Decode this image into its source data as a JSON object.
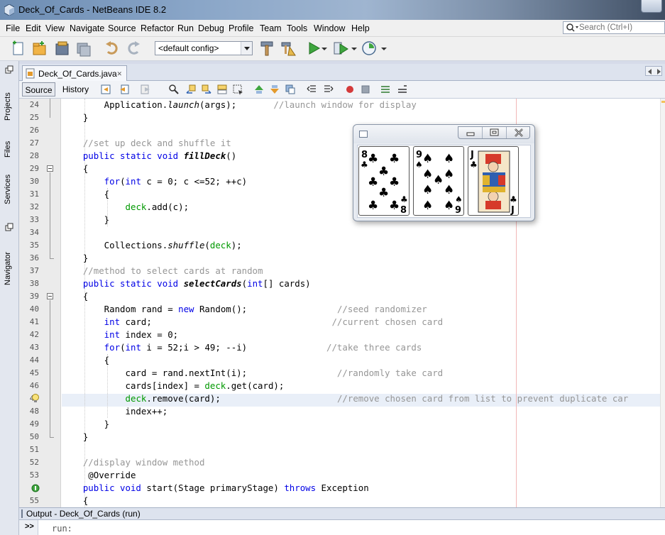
{
  "window": {
    "title": "Deck_Of_Cards - NetBeans IDE 8.2"
  },
  "menu": [
    "File",
    "Edit",
    "View",
    "Navigate",
    "Source",
    "Refactor",
    "Run",
    "Debug",
    "Profile",
    "Team",
    "Tools",
    "Window",
    "Help"
  ],
  "search": {
    "placeholder": "Search (Ctrl+I)"
  },
  "toolbar": {
    "config": "<default config>"
  },
  "sidebar": {
    "tabs": [
      "Projects",
      "Files",
      "Services",
      "Navigator"
    ]
  },
  "editor": {
    "tab": "Deck_Of_Cards.java",
    "source_label": "Source",
    "history_label": "History",
    "lines": [
      {
        "n": "24",
        "segs": [
          [
            "",
            "        Application."
          ],
          [
            "it",
            "launch"
          ],
          [
            "",
            "(args);       "
          ],
          [
            "cm",
            "//launch window for display"
          ]
        ]
      },
      {
        "n": "25",
        "segs": [
          [
            "",
            "    }"
          ]
        ]
      },
      {
        "n": "26",
        "segs": [
          [
            "",
            ""
          ]
        ]
      },
      {
        "n": "27",
        "segs": [
          [
            "cm",
            "    //set up deck and shuffle it"
          ]
        ]
      },
      {
        "n": "28",
        "segs": [
          [
            "kw",
            "    public static void "
          ],
          [
            "bi",
            "fillDeck"
          ],
          [
            "",
            "()"
          ]
        ]
      },
      {
        "n": "29",
        "segs": [
          [
            "",
            "    {"
          ]
        ]
      },
      {
        "n": "30",
        "segs": [
          [
            "kw",
            "        for"
          ],
          [
            "",
            "("
          ],
          [
            "kw",
            "int"
          ],
          [
            "",
            " c = 0; c <=52; ++c)"
          ]
        ]
      },
      {
        "n": "31",
        "segs": [
          [
            "",
            "        {"
          ]
        ]
      },
      {
        "n": "32",
        "segs": [
          [
            "",
            "            "
          ],
          [
            "fld",
            "deck"
          ],
          [
            "",
            ".add(c);"
          ]
        ]
      },
      {
        "n": "33",
        "segs": [
          [
            "",
            "        }"
          ]
        ]
      },
      {
        "n": "34",
        "segs": [
          [
            "",
            ""
          ]
        ]
      },
      {
        "n": "35",
        "segs": [
          [
            "",
            "        Collections."
          ],
          [
            "it",
            "shuffle"
          ],
          [
            "",
            "("
          ],
          [
            "fld",
            "deck"
          ],
          [
            "",
            ");"
          ]
        ]
      },
      {
        "n": "36",
        "segs": [
          [
            "",
            "    }"
          ]
        ]
      },
      {
        "n": "37",
        "segs": [
          [
            "cm",
            "    //method to select cards at random"
          ]
        ]
      },
      {
        "n": "38",
        "segs": [
          [
            "kw",
            "    public static void "
          ],
          [
            "bi",
            "selectCards"
          ],
          [
            "",
            "("
          ],
          [
            "kw",
            "int"
          ],
          [
            "",
            "[] cards)"
          ]
        ]
      },
      {
        "n": "39",
        "segs": [
          [
            "",
            "    {"
          ]
        ]
      },
      {
        "n": "40",
        "segs": [
          [
            "",
            "        Random rand = "
          ],
          [
            "kw",
            "new"
          ],
          [
            "",
            " Random();                 "
          ],
          [
            "cm",
            "//seed randomizer"
          ]
        ]
      },
      {
        "n": "41",
        "segs": [
          [
            "kw",
            "        int"
          ],
          [
            "",
            " card;                                  "
          ],
          [
            "cm",
            "//current chosen card"
          ]
        ]
      },
      {
        "n": "42",
        "segs": [
          [
            "kw",
            "        int"
          ],
          [
            "",
            " index = 0;"
          ]
        ]
      },
      {
        "n": "43",
        "segs": [
          [
            "kw",
            "        for"
          ],
          [
            "",
            "("
          ],
          [
            "kw",
            "int"
          ],
          [
            "",
            " i = 52;i > 49; --i)               "
          ],
          [
            "cm",
            "//take three cards"
          ]
        ]
      },
      {
        "n": "44",
        "segs": [
          [
            "",
            "        {"
          ]
        ]
      },
      {
        "n": "45",
        "segs": [
          [
            "",
            "            card = rand.nextInt(i);                 "
          ],
          [
            "cm",
            "//randomly take card"
          ]
        ]
      },
      {
        "n": "46",
        "segs": [
          [
            "",
            "            cards[index] = "
          ],
          [
            "fld",
            "deck"
          ],
          [
            "",
            ".get(card);"
          ]
        ]
      },
      {
        "n": "47",
        "segs": [
          [
            "",
            "            "
          ],
          [
            "fld",
            "deck"
          ],
          [
            "",
            ".remove(card);                      "
          ],
          [
            "cm",
            "//remove chosen card from list to prevent duplicate car"
          ]
        ]
      },
      {
        "n": "48",
        "segs": [
          [
            "",
            "            index++;"
          ]
        ]
      },
      {
        "n": "49",
        "segs": [
          [
            "",
            "        }"
          ]
        ]
      },
      {
        "n": "50",
        "segs": [
          [
            "",
            "    }"
          ]
        ]
      },
      {
        "n": "51",
        "segs": [
          [
            "",
            ""
          ]
        ]
      },
      {
        "n": "52",
        "segs": [
          [
            "cm",
            "    //display window method"
          ]
        ]
      },
      {
        "n": "53",
        "segs": [
          [
            "",
            "     @Override"
          ]
        ]
      },
      {
        "n": "",
        "segs": [
          [
            "kw",
            "    public void "
          ],
          [
            "",
            "start(Stage primaryStage) "
          ],
          [
            "kw",
            "throws"
          ],
          [
            "",
            " Exception"
          ]
        ]
      },
      {
        "n": "55",
        "segs": [
          [
            "",
            "    {"
          ]
        ]
      }
    ]
  },
  "output": {
    "title": "Output - Deck_Of_Cards (run)",
    "rerun": ">>",
    "log": "run:"
  },
  "card_window": {
    "buttons": [
      "minimize",
      "restore",
      "close"
    ],
    "cards": [
      {
        "rank": "8",
        "suit": "clubs",
        "glyph": "♣"
      },
      {
        "rank": "9",
        "suit": "spades",
        "glyph": "♠"
      },
      {
        "rank": "J",
        "suit": "clubs",
        "glyph": "♣"
      }
    ]
  },
  "colors": {
    "keyword": "#0000e6",
    "comment": "#969696",
    "field": "#009900",
    "accent": "#6d8db3"
  }
}
